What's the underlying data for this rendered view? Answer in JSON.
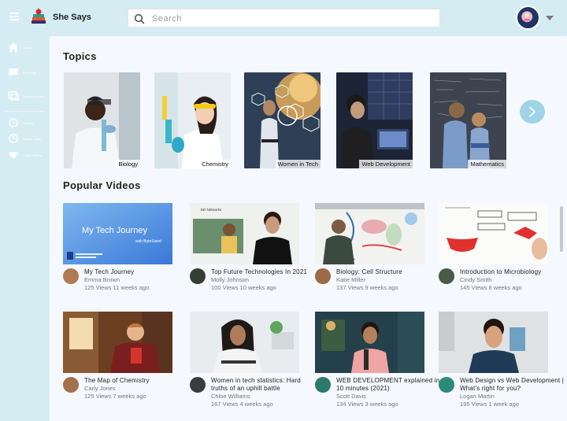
{
  "app": {
    "title": "She Says"
  },
  "search": {
    "placeholder": "Search"
  },
  "sidebar": {
    "items": [
      {
        "label": "Home",
        "icon": "home-icon"
      },
      {
        "label": "Message",
        "icon": "chat-icon"
      },
      {
        "label": "Subscriptions",
        "icon": "subscriptions-icon"
      },
      {
        "label": "History",
        "icon": "history-icon"
      },
      {
        "label": "Watch Later",
        "icon": "clock-icon"
      },
      {
        "label": "Liked Videos",
        "icon": "heart-icon"
      }
    ]
  },
  "sections": {
    "topics": "Topics",
    "popular": "Popular Videos"
  },
  "topics": [
    {
      "label": "Biology"
    },
    {
      "label": "Chemistry"
    },
    {
      "label": "Women in Tech"
    },
    {
      "label": "Web Development"
    },
    {
      "label": "Mathematics"
    }
  ],
  "videos": [
    {
      "title": "My Tech Journey",
      "author": "Emma Brown",
      "stats": "125 Views 11 weeks ago",
      "thumb_text": "My Tech Journey",
      "thumb_sub": "with ByteSized"
    },
    {
      "title": "Top Future Technologies In 2021",
      "author": "Molly Johnson",
      "stats": "100 Views 10 weeks ago",
      "thumb_text": "ED Networks"
    },
    {
      "title": "Biology: Cell Structure",
      "author": "Katie Miller",
      "stats": "137 Views 9 weeks ago"
    },
    {
      "title": "Introduction to Microbiology",
      "author": "Cindy Smith",
      "stats": "145 Views 8 weeks ago"
    },
    {
      "title": "The Map of Chemistry",
      "author": "Carly Jones",
      "stats": "125 Views 7 weeks ago"
    },
    {
      "title": "Women in tech statistics: Hard truths of an uphill battle",
      "author": "Chloe Williams",
      "stats": "167 Views 4 weeks ago"
    },
    {
      "title": "WEB DEVELOPMENT explained in 10 minutes (2021)",
      "author": "Scott Davis",
      "stats": "134 Views 3 weeks ago"
    },
    {
      "title": "Web Design vs Web Development | What's right for you?",
      "author": "Logan Martin",
      "stats": "195 Views 1 week ago"
    }
  ],
  "colors": {
    "sidebar": "#d5ecf3",
    "main": "#f5f8fc",
    "accent": "#9fd3e8"
  }
}
